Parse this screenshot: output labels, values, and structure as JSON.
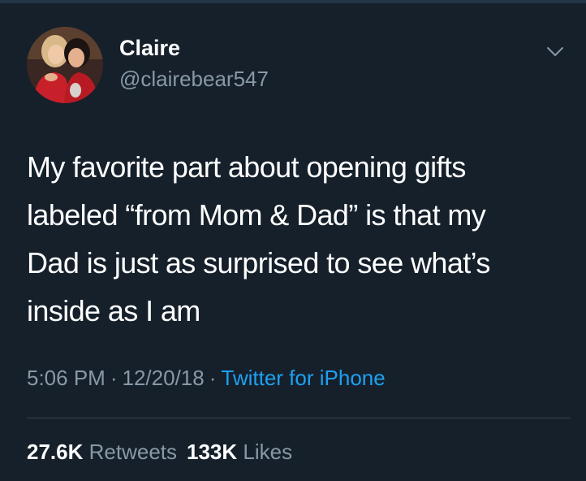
{
  "user": {
    "name": "Claire",
    "handle": "@clairebear547"
  },
  "tweet": {
    "text": "My favorite part about opening gifts\nlabeled “from Mom & Dad” is that my\nDad is just as surprised to see what’s\ninside as I am",
    "time": "5:06 PM",
    "date": "12/20/18",
    "separator": "·",
    "source": "Twitter for iPhone"
  },
  "stats": {
    "retweets_count": "27.6K",
    "retweets_label": "Retweets",
    "likes_count": "133K",
    "likes_label": "Likes"
  },
  "icons": {
    "menu": "chevron-down-icon"
  },
  "colors": {
    "background": "#15202b",
    "secondary_text": "#8899a6",
    "link": "#1da1f2",
    "divider": "#38444d"
  }
}
